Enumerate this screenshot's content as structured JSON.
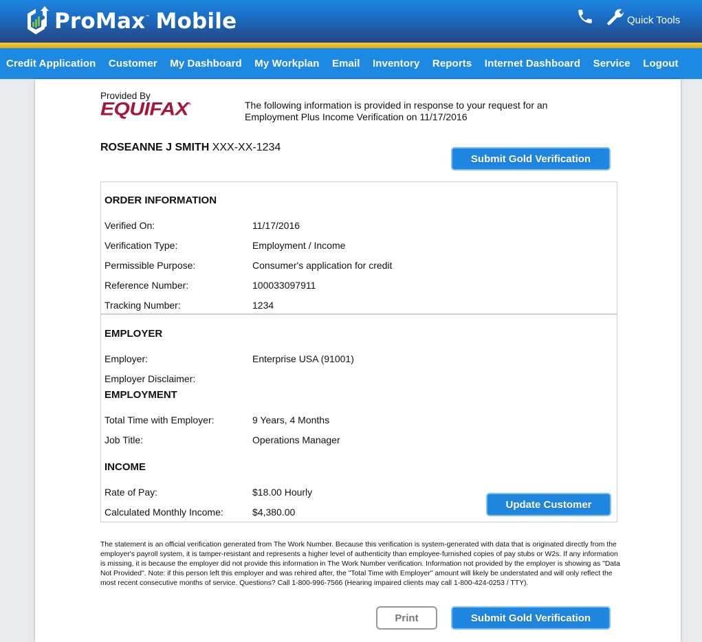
{
  "header": {
    "brand": "ProMax",
    "brand_tm": "™",
    "brand_suffix": "Mobile",
    "quick_tools_label": "Quick Tools",
    "icons": {
      "logo": "promax-chart-arrow-icon",
      "phone": "phone-icon",
      "wrench": "wrench-icon"
    }
  },
  "nav": {
    "items": [
      {
        "label": "Credit Application"
      },
      {
        "label": "Customer"
      },
      {
        "label": "My Dashboard"
      },
      {
        "label": "My Workplan"
      },
      {
        "label": "Email"
      },
      {
        "label": "Inventory"
      },
      {
        "label": "Reports"
      },
      {
        "label": "Internet Dashboard"
      },
      {
        "label": "Service"
      },
      {
        "label": "Logout"
      }
    ]
  },
  "report": {
    "provided_by": "Provided By",
    "provider_logo": "EQUIFAX",
    "provider_reg": "®",
    "intro_line1": "The following information is provided in response to your request for an",
    "intro_line2": "Employment Plus Income Verification on 11/17/2016",
    "applicant_name": "ROSEANNE J SMITH",
    "applicant_ssn": "XXX-XX-1234",
    "order_information": {
      "title": "ORDER INFORMATION",
      "rows": [
        {
          "label": "Verified On:",
          "value": "11/17/2016"
        },
        {
          "label": "Verification Type:",
          "value": "Employment / Income"
        },
        {
          "label": "Permissible Purpose:",
          "value": "Consumer's application for credit"
        },
        {
          "label": "Reference Number:",
          "value": "100033097911"
        },
        {
          "label": "Tracking Number:",
          "value": "1234"
        }
      ]
    },
    "employer": {
      "title": "EMPLOYER",
      "rows": [
        {
          "label": "Employer:",
          "value": "Enterprise USA (91001)"
        },
        {
          "label": "Employer Disclaimer:",
          "value": ""
        }
      ]
    },
    "employment": {
      "title": "EMPLOYMENT",
      "rows": [
        {
          "label": "Total Time with Employer:",
          "value": "9 Years, 4 Months"
        },
        {
          "label": "Job Title:",
          "value": "Operations Manager"
        }
      ]
    },
    "income": {
      "title": "INCOME",
      "rows": [
        {
          "label": "Rate of Pay:",
          "value": "$18.00 Hourly"
        },
        {
          "label": "Calculated Monthly Income:",
          "value": "$4,380.00"
        }
      ]
    },
    "disclaimer": "The statement is an official verification generated from The Work Number. Because this verification is system-generated with data that is originated directly from the employer's payroll system, it is tamper-resistant and represents a higher level of authenticity than employee-furnished copies of pay stubs or W2s. If any information is missing, it is because the employer did not provide this information in The Work Number verification. Information not provided by the employer is showing as \"Data Not Provided\". Note: if this person left this employer and was rehired after, the \"Total Time with Employer\" amount will likely be understated and will only reflect the most recent consecutive months of service. Questions? Call 1-800-996-7566 (Hearing impaired clients may call 1-800-424-0253 / TTY)."
  },
  "buttons": {
    "submit_gold_verification": "Submit Gold Verification",
    "update_customer": "Update Customer",
    "print": "Print"
  },
  "colors": {
    "nav_blue": "#1e89e3",
    "gold_accent": "#e0b52a",
    "equifax_red": "#a5163a",
    "button_blue": "#1f86e0",
    "logo_green": "#7bc043"
  }
}
